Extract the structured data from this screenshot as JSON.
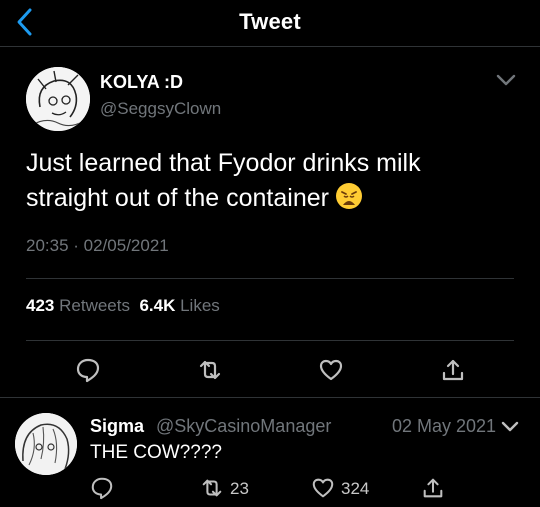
{
  "header": {
    "title": "Tweet"
  },
  "tweet": {
    "author_name": "KOLYA :D",
    "handle": "@SeggsyClown",
    "text": "Just learned that Fyodor drinks milk straight out of the container",
    "emoji": "weary-face",
    "timestamp": "20:35 · 02/05/2021",
    "stats": {
      "retweets_count": "423",
      "retweets_label": "Retweets",
      "likes_count": "6.4K",
      "likes_label": "Likes"
    }
  },
  "reply": {
    "author_name": "Sigma",
    "handle": "@SkyCasinoManager",
    "date": "02 May 2021",
    "text": "THE COW????",
    "retweets": "23",
    "likes": "324"
  },
  "colors": {
    "background": "#000000",
    "accent": "#1d9bf0",
    "secondary_text": "#71767b"
  }
}
